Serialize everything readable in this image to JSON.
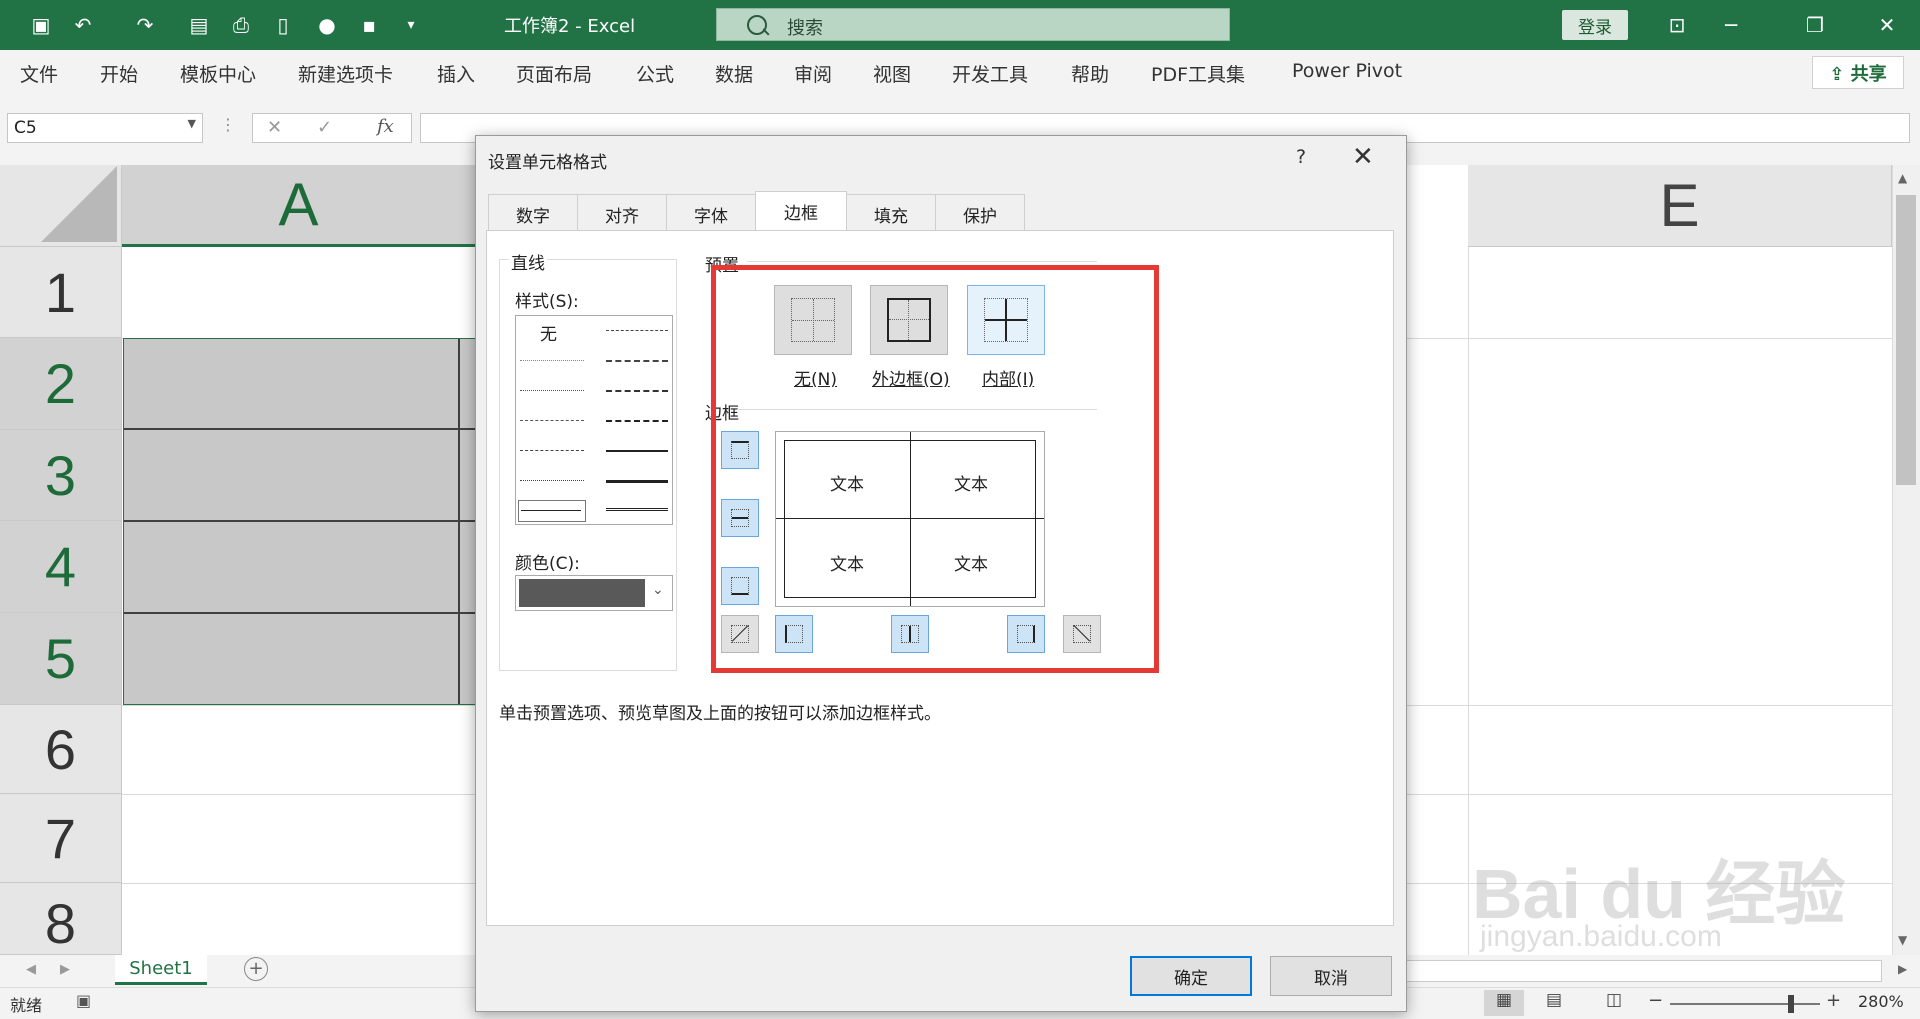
{
  "titlebar": {
    "doc_title": "工作簿2  -  Excel",
    "search_placeholder": "搜索",
    "login_label": "登录"
  },
  "ribbon": {
    "tabs": [
      "文件",
      "开始",
      "模板中心",
      "新建选项卡",
      "插入",
      "页面布局",
      "公式",
      "数据",
      "审阅",
      "视图",
      "开发工具",
      "帮助",
      "PDF工具集",
      "Power Pivot"
    ],
    "share_label": "共享"
  },
  "formula_bar": {
    "name_box": "C5",
    "cancel_icon": "✕",
    "enter_icon": "✓",
    "fx_label": "fx",
    "formula": ""
  },
  "grid": {
    "columns": [
      "A",
      "E"
    ],
    "rows": [
      "1",
      "2",
      "3",
      "4",
      "5",
      "6",
      "7",
      "8"
    ],
    "selected_rows": [
      "2",
      "3",
      "4",
      "5"
    ]
  },
  "sheets": {
    "tabs": [
      "Sheet1"
    ]
  },
  "status": {
    "ready": "就绪",
    "zoom": "280%"
  },
  "dialog": {
    "title": "设置单元格格式",
    "help": "?",
    "tabs": [
      "数字",
      "对齐",
      "字体",
      "边框",
      "填充",
      "保护"
    ],
    "active_tab": "边框",
    "line_group_label": "直线",
    "style_label": "样式(S):",
    "style_none": "无",
    "color_label": "颜色(C):",
    "color_value": "#595959",
    "preset_label": "预置",
    "presets": [
      {
        "label": "无(N)",
        "icon": "border-none-icon"
      },
      {
        "label": "外边框(O)",
        "icon": "border-outline-icon"
      },
      {
        "label": "内部(I)",
        "icon": "border-inside-icon"
      }
    ],
    "border_label": "边框",
    "preview_text": [
      "文本",
      "文本",
      "文本",
      "文本"
    ],
    "hint": "单击预置选项、预览草图及上面的按钮可以添加边框样式。",
    "ok_label": "确定",
    "cancel_label": "取消"
  },
  "watermark": {
    "brand": "Bai du 经验",
    "url": "jingyan.baidu.com"
  }
}
